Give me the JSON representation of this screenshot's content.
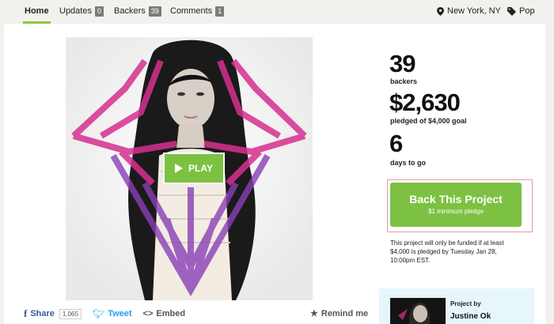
{
  "nav": {
    "tabs": [
      {
        "label": "Home",
        "badge": null
      },
      {
        "label": "Updates",
        "badge": "0"
      },
      {
        "label": "Backers",
        "badge": "39"
      },
      {
        "label": "Comments",
        "badge": "1"
      }
    ],
    "location": "New York, NY",
    "category": "Pop"
  },
  "video": {
    "play_label": "PLAY"
  },
  "stats": {
    "backers_count": "39",
    "backers_label": "backers",
    "pledged_amount": "$2,630",
    "pledged_label": "pledged of $4,000 goal",
    "days_count": "6",
    "days_label": "days to go"
  },
  "back_project": {
    "title": "Back This Project",
    "subtitle": "$1 minimum pledge",
    "note": "This project will only be funded if at least $4,000 is pledged by Tuesday Jan 28, 10:00pm EST."
  },
  "share": {
    "facebook_label": "Share",
    "facebook_count": "1,065",
    "twitter_label": "Tweet",
    "embed_label": "Embed",
    "remind_label": "Remind me"
  },
  "creator": {
    "label": "Project by",
    "name": "Justine Ok"
  },
  "colors": {
    "accent_green": "#7dc142",
    "facebook_blue": "#3b5998",
    "twitter_blue": "#1da1f2",
    "magenta_art": "#d6308f",
    "purple_art": "#8a3fb6"
  }
}
